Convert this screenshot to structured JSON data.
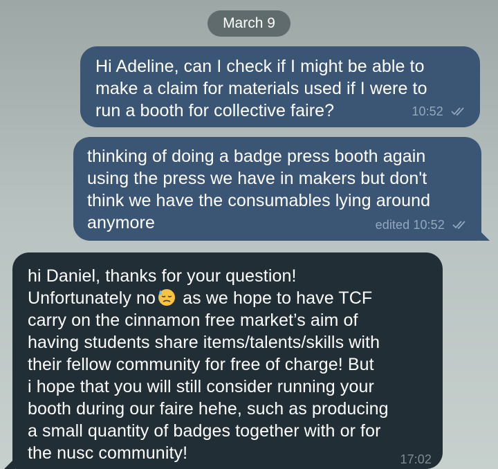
{
  "date_separator": "March 9",
  "messages": [
    {
      "direction": "outgoing",
      "lines": [
        "Hi Adeline, can I check if I might be able to",
        "make a claim for materials used if I were to",
        "run a booth for collective faire?"
      ],
      "time": "10:52",
      "status_icon": "double-check-icon"
    },
    {
      "direction": "outgoing",
      "lines": [
        "thinking of doing a badge press booth again",
        "using the press we have in makers but don't",
        "think we have the consumables lying around",
        "anymore"
      ],
      "time": "edited 10:52",
      "status_icon": "double-check-icon"
    },
    {
      "direction": "incoming",
      "lines": [
        "hi Daniel, thanks for your question!",
        "Unfortunately no",
        "as we hope to have TCF",
        "carry on the cinnamon free market’s aim of",
        "having students share items/talents/skills with",
        "their fellow community for free of charge! But",
        "i hope that you will still consider running your",
        "booth during our faire hehe, such as producing",
        "a small quantity of badges together with or for",
        "the nusc community!"
      ],
      "emoji_after_line_1": "downcast-sweat-emoji",
      "time": "17:02"
    }
  ],
  "colors": {
    "outgoing_bubble": "#3b5675",
    "incoming_bubble": "#222e35",
    "date_pill": "#5f6b6d"
  }
}
